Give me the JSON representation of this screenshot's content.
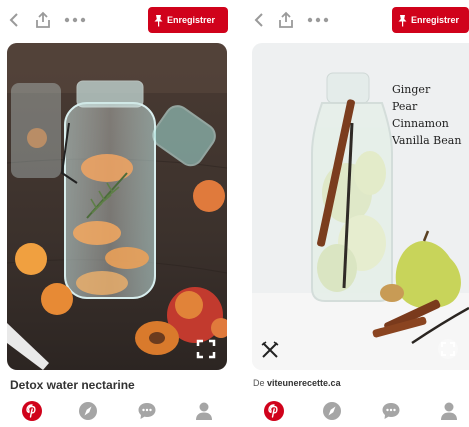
{
  "left_pin": {
    "save_label": "Enregistrer",
    "title": "Detox water nectarine"
  },
  "right_pin": {
    "save_label": "Enregistrer",
    "source_prefix": "De",
    "source_domain": "viteunerecette.ca",
    "ingredients": [
      "Ginger",
      "Pear",
      "Cinnamon",
      "Vanilla Bean"
    ]
  },
  "colors": {
    "accent": "#d0021b",
    "icon_gray": "#a5a5a5",
    "title_text": "#333333"
  },
  "icons": [
    "back-icon",
    "share-icon",
    "more-icon",
    "pushpin-icon",
    "expand-icon",
    "pinterest-icon",
    "explore-icon",
    "messages-icon",
    "profile-icon",
    "cutlery-icon"
  ]
}
